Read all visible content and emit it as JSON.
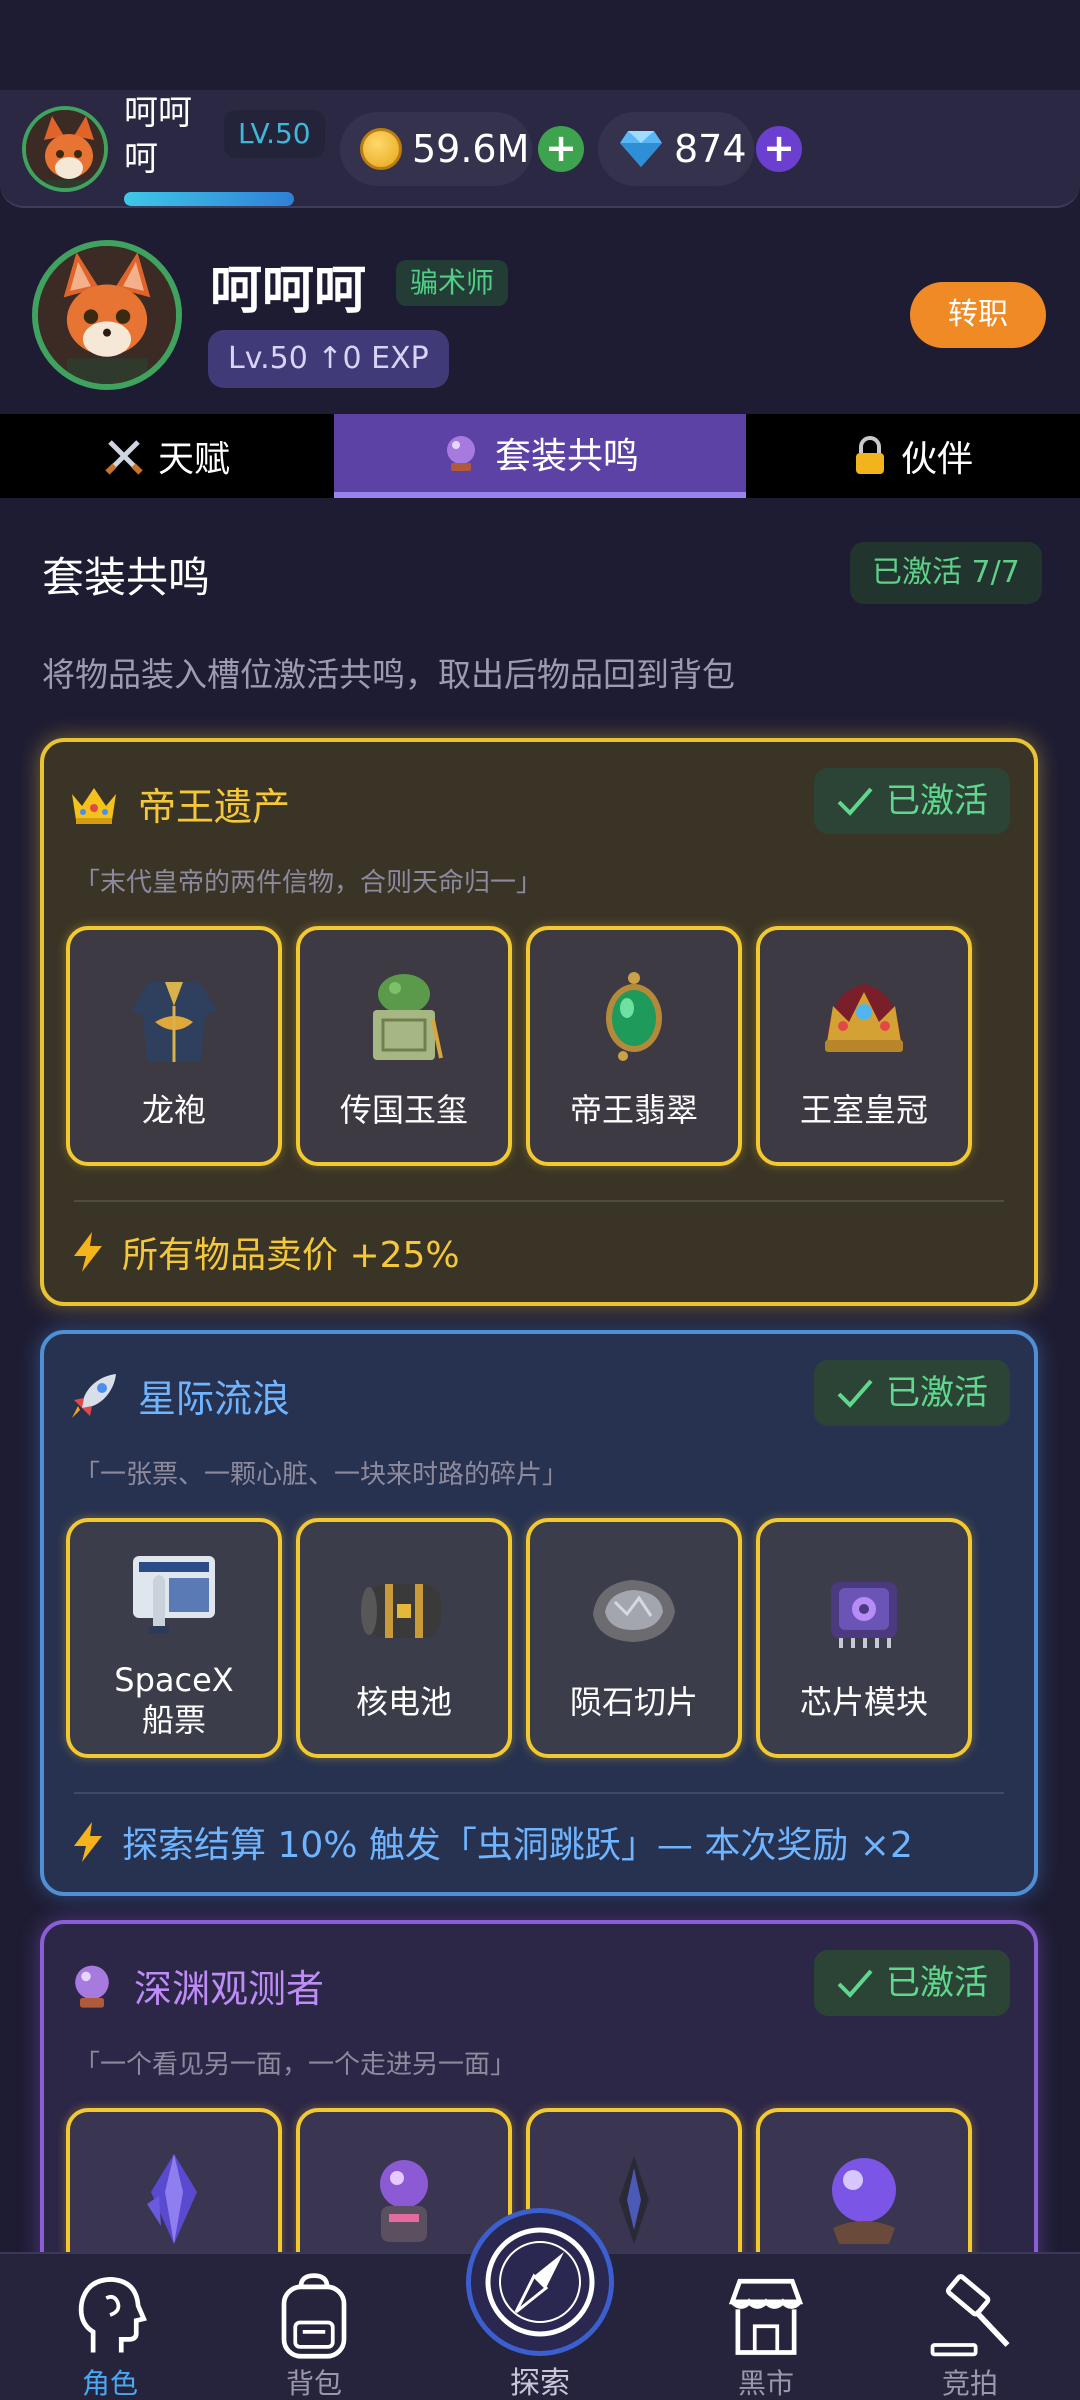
{
  "topbar": {
    "player_name": "呵呵呵",
    "level": "LV.50",
    "exp_progress": 0.22,
    "coins": "59.6M",
    "gems": "874",
    "plus": "+"
  },
  "profile": {
    "name": "呵呵呵",
    "class_badge": "骗术师",
    "level_exp": "Lv.50  ↑0 EXP",
    "job_button": "转职"
  },
  "tabs": [
    {
      "label": "天赋",
      "icon": "crossed-swords-icon"
    },
    {
      "label": "套装共鸣",
      "icon": "crystal-ball-icon",
      "active": true
    },
    {
      "label": "伙伴",
      "icon": "lock-icon"
    }
  ],
  "section": {
    "title": "套装共鸣",
    "count": "已激活 7/7",
    "description": "将物品装入槽位激活共鸣，取出后物品回到背包"
  },
  "sets": [
    {
      "name": "帝王遗产",
      "icon": "crown-icon",
      "status": "已激活",
      "quote": "「末代皇帝的两件信物，合则天命归一」",
      "items": [
        "龙袍",
        "传国玉玺",
        "帝王翡翠",
        "王室皇冠"
      ],
      "bonus": "所有物品卖价 +25%",
      "color": "#e8c332"
    },
    {
      "name": "星际流浪",
      "icon": "rocket-icon",
      "status": "已激活",
      "quote": "「一张票、一颗心脏、一块来时路的碎片」",
      "items": [
        "SpaceX\n船票",
        "核电池",
        "陨石切片",
        "芯片模块"
      ],
      "bonus": "探索结算 10% 触发「虫洞跳跃」— 本次奖励 ×2",
      "color": "#4e8fd6"
    },
    {
      "name": "深渊观测者",
      "icon": "crystal-ball-icon",
      "status": "已激活",
      "quote": "「一个看见另一面，一个走进另一面」",
      "items": [
        "",
        "",
        "",
        ""
      ],
      "color": "#8a5ed6"
    }
  ],
  "nav": {
    "role": "角色",
    "bag": "背包",
    "explore": "探索",
    "market": "黑市",
    "auction": "竞拍"
  }
}
